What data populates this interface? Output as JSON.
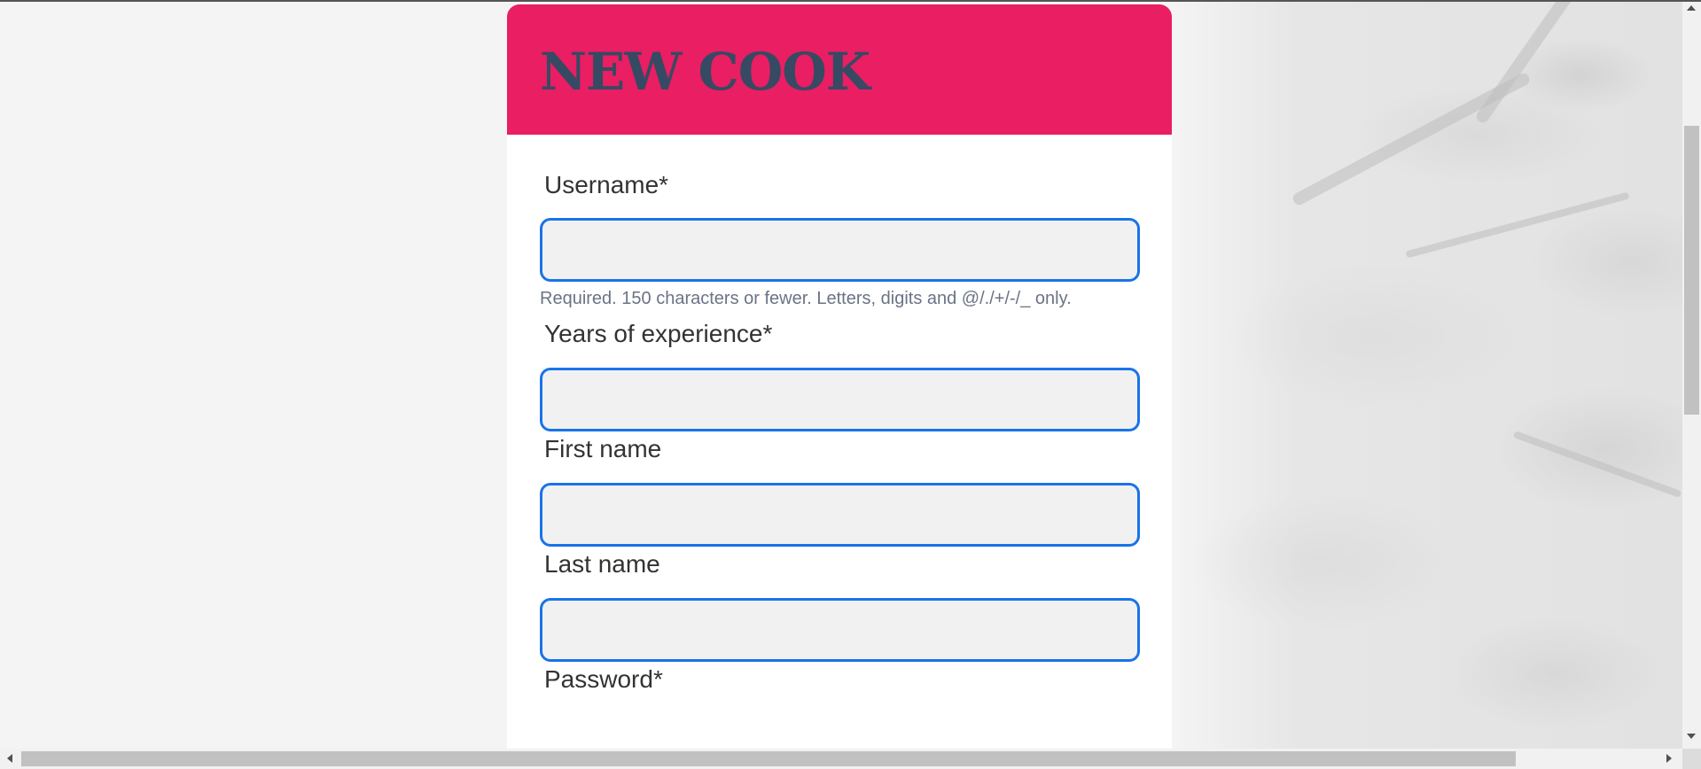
{
  "form": {
    "title": "NEW COOK",
    "fields": [
      {
        "label": "Username*",
        "value": "",
        "help": "Required. 150 characters or fewer. Letters, digits and @/./+/-/_ only."
      },
      {
        "label": "Years of experience*",
        "value": ""
      },
      {
        "label": "First name",
        "value": ""
      },
      {
        "label": "Last name",
        "value": ""
      },
      {
        "label": "Password*"
      }
    ]
  },
  "colors": {
    "header_bg": "#e91e63",
    "title_text": "#364a63",
    "input_border": "#1a73e8",
    "input_bg": "#f1f1f1",
    "help_text": "#6b7385"
  }
}
